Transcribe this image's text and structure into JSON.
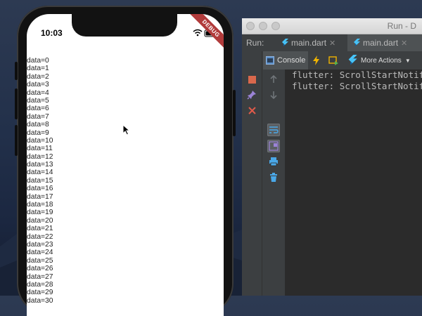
{
  "phone": {
    "status_time": "10:03",
    "debug_badge": "DEBUG",
    "list_items": [
      "data=0",
      "data=1",
      "data=2",
      "data=3",
      "data=4",
      "data=5",
      "data=6",
      "data=7",
      "data=8",
      "data=9",
      "data=10",
      "data=11",
      "data=12",
      "data=13",
      "data=14",
      "data=15",
      "data=16",
      "data=17",
      "data=18",
      "data=19",
      "data=20",
      "data=21",
      "data=22",
      "data=23",
      "data=24",
      "data=25",
      "data=26",
      "data=27",
      "data=28",
      "data=29",
      "data=30"
    ]
  },
  "ide": {
    "window_title": "Run - D",
    "run_label": "Run:",
    "tabs": [
      {
        "label": "main.dart"
      },
      {
        "label": "main.dart"
      }
    ],
    "console_label": "Console",
    "more_actions_label": "More Actions",
    "console_lines": [
      "flutter: ScrollStartNotif",
      "flutter: ScrollStartNotif"
    ]
  },
  "icons": {
    "stop": "stop-icon",
    "pin": "pin-icon",
    "close": "close-icon",
    "up": "arrow-up-icon",
    "down": "arrow-down-icon",
    "wrap": "soft-wrap-icon",
    "scroll_end": "scroll-to-end-icon",
    "print": "print-icon",
    "trash": "trash-icon",
    "lightning": "hot-reload-icon",
    "restart": "hot-restart-icon",
    "flutter": "flutter-icon"
  },
  "colors": {
    "stop_red": "#d9684c",
    "close_red": "#e05a4a",
    "accent_blue": "#4aa8e8",
    "lightning_yellow": "#f0b400"
  }
}
